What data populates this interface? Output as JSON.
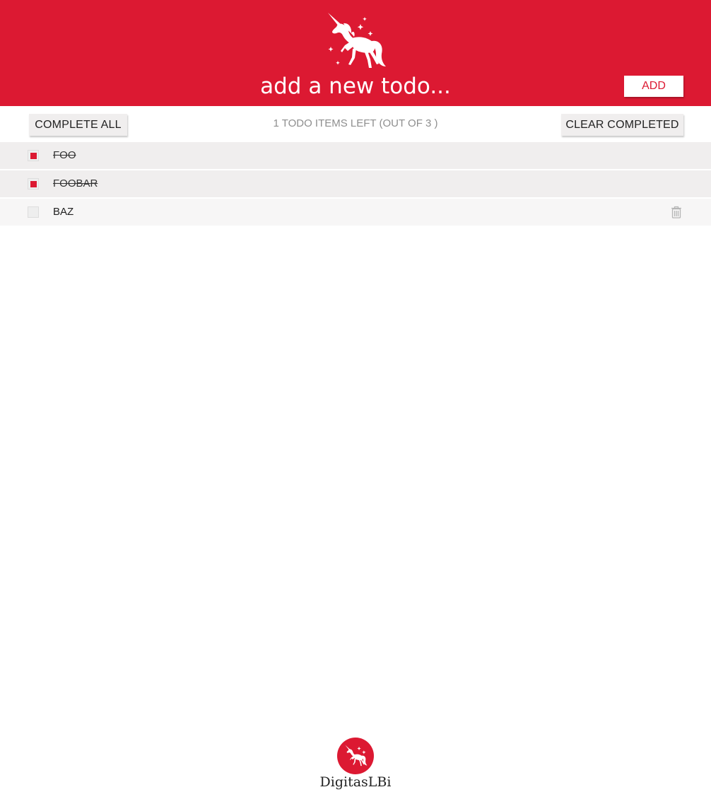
{
  "header": {
    "input_placeholder": "add a new todo...",
    "input_value": "",
    "add_label": "ADD",
    "background_color": "#dc1932",
    "logo_icon": "unicorn-icon"
  },
  "toolbar": {
    "complete_all_label": "COMPLETE ALL",
    "items_left_text": "1 TODO ITEMS LEFT (OUT OF 3 )",
    "clear_completed_label": "CLEAR COMPLETED"
  },
  "todos": [
    {
      "label": "FOO",
      "completed": true
    },
    {
      "label": "FOOBAR",
      "completed": true
    },
    {
      "label": "BAZ",
      "completed": false
    }
  ],
  "footer": {
    "brand": "DigitasLBi",
    "logo_icon": "unicorn-badge-icon"
  }
}
